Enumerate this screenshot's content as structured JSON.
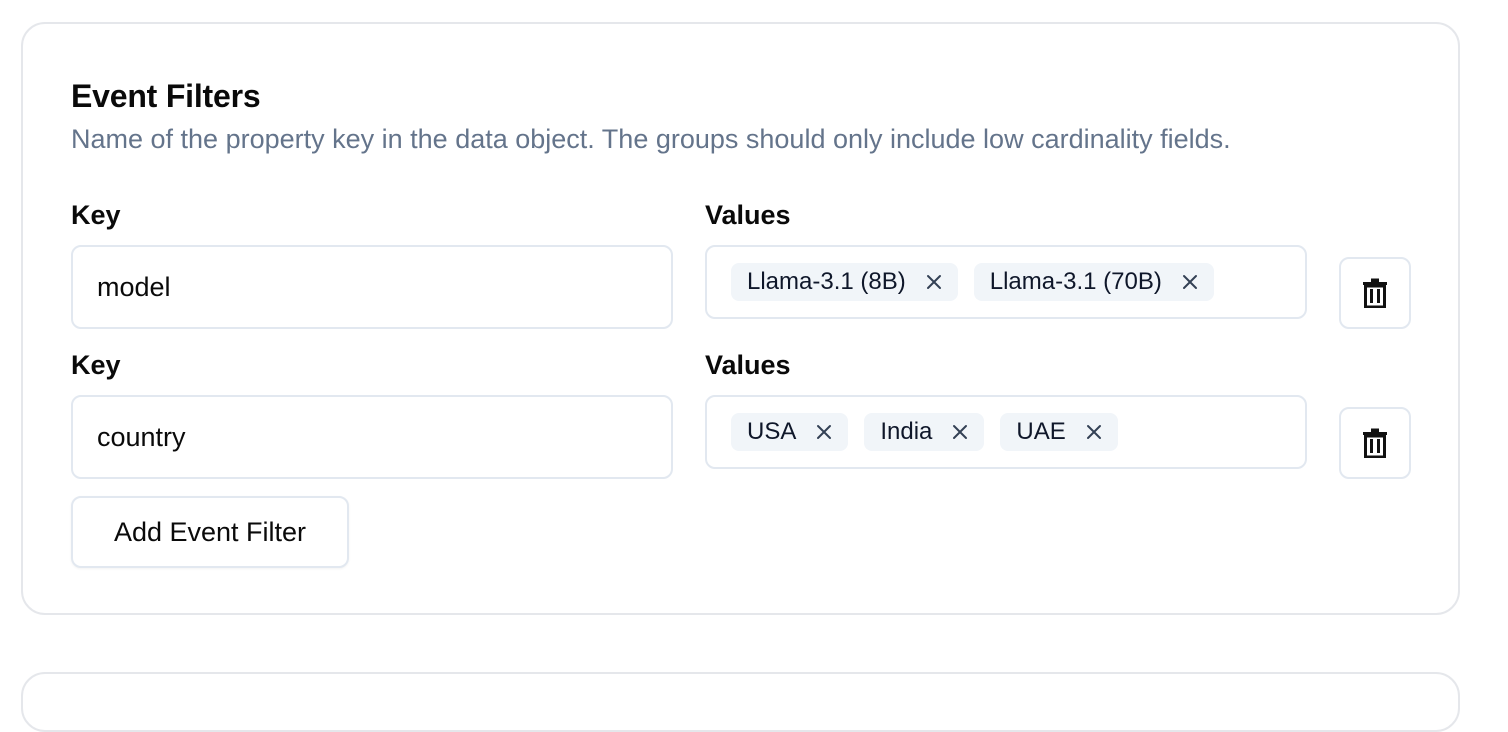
{
  "section": {
    "title": "Event Filters",
    "description": "Name of the property key in the data object. The groups should only include low cardinality fields."
  },
  "filters": [
    {
      "key_label": "Key",
      "key_value": "model",
      "values_label": "Values",
      "values": [
        "Llama-3.1 (8B)",
        "Llama-3.1 (70B)"
      ]
    },
    {
      "key_label": "Key",
      "key_value": "country",
      "values_label": "Values",
      "values": [
        "USA",
        "India",
        "UAE"
      ]
    }
  ],
  "add_button": {
    "label": "Add Event Filter"
  },
  "icons": {
    "remove_chip": "close-icon",
    "delete_filter": "trash-icon"
  },
  "colors": {
    "border": "#e2e8f0",
    "chip_bg": "#f1f5f9",
    "muted_text": "#64748b"
  }
}
